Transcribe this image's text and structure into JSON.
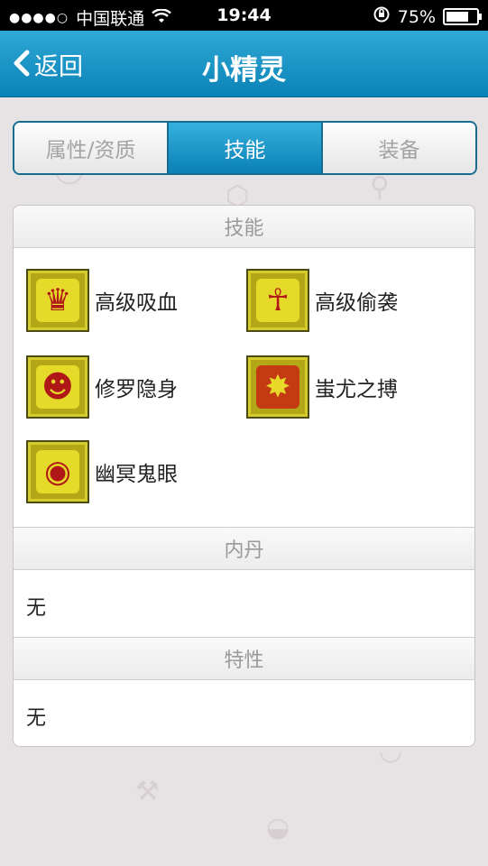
{
  "status_bar": {
    "carrier": "中国联通",
    "time": "19:44",
    "battery": "75%"
  },
  "nav": {
    "back_label": "返回",
    "title": "小精灵"
  },
  "tabs": [
    {
      "label": "属性/资质",
      "active": false
    },
    {
      "label": "技能",
      "active": true
    },
    {
      "label": "装备",
      "active": false
    }
  ],
  "sections": {
    "skills_header": "技能",
    "skills": [
      {
        "name": "高级吸血",
        "icon": "fang-icon"
      },
      {
        "name": "高级偷袭",
        "icon": "sneak-figure-icon"
      },
      {
        "name": "修罗隐身",
        "icon": "demon-face-icon"
      },
      {
        "name": "蚩尤之搏",
        "icon": "claw-strike-icon"
      },
      {
        "name": "幽冥鬼眼",
        "icon": "eye-icon"
      }
    ],
    "neidan_header": "内丹",
    "neidan_value": "无",
    "trait_header": "特性",
    "trait_value": "无"
  },
  "colors": {
    "nav_bar": "#1797c8",
    "tab_active": "#1a93c7",
    "skill_icon_bg": "#b3a718"
  }
}
